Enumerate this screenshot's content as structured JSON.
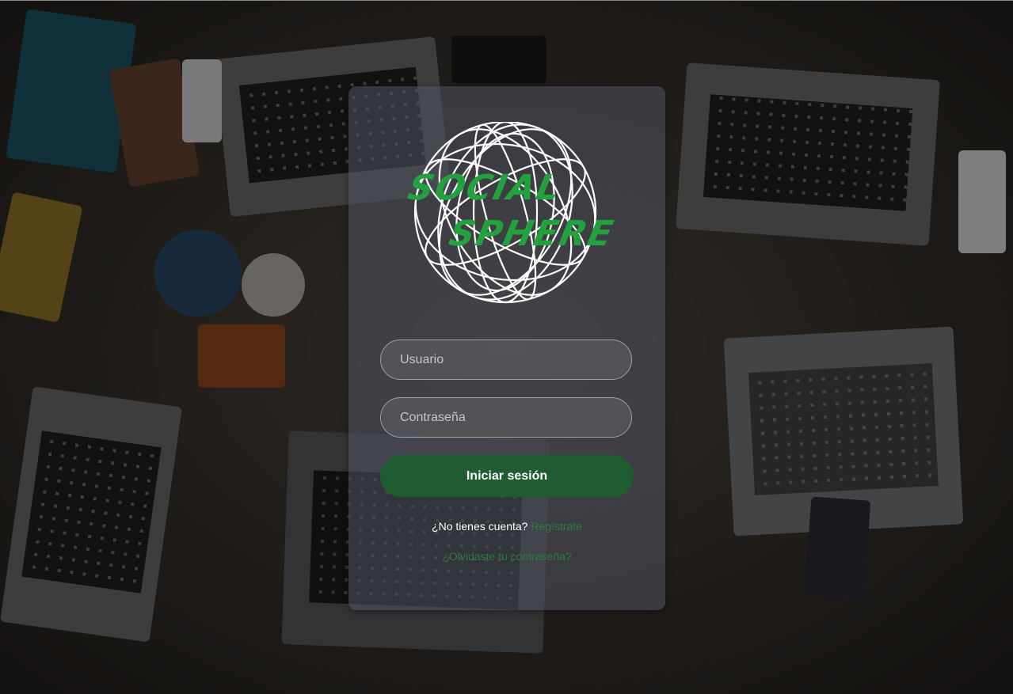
{
  "brand": {
    "line1": "SOCIAL",
    "line2": "SPHERE",
    "text_color": "#22a13e",
    "globe_color": "#ffffff"
  },
  "form": {
    "username_placeholder": "Usuario",
    "password_placeholder": "Contraseña",
    "login_label": "Iniciar sesión"
  },
  "links": {
    "no_account_text": "¿No tienes cuenta?",
    "register_label": "Regístrate",
    "forgot_label": "¿Olvidaste tu contraseña?"
  },
  "colors": {
    "accent": "#1f5c32",
    "link": "#2e7a3f",
    "card": "rgba(80,84,98,0.55)"
  }
}
